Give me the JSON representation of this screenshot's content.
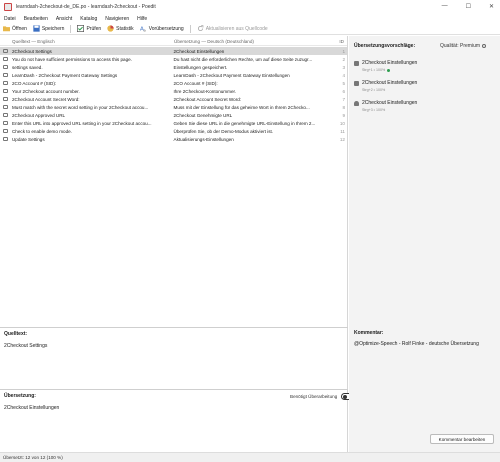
{
  "window": {
    "title": "learndash-2checkout-de_DE.po - learndash-2checkout - Poedit",
    "min": "—",
    "max": "☐",
    "close": "✕"
  },
  "menu": [
    "Datei",
    "Bearbeiten",
    "Ansicht",
    "Katalog",
    "Navigieren",
    "Hilfe"
  ],
  "toolbar": {
    "open": "Öffnen",
    "save": "Speichern",
    "validate": "Prüfen",
    "stats": "Statistik",
    "pretranslate": "Vorübersetzung",
    "update": "Aktualisieren aus Quellcode"
  },
  "list": {
    "headers": {
      "source": "Quelltext — Englisch",
      "target": "Übersetzung — Deutsch (Deutschland)",
      "id": "ID"
    },
    "rows": [
      {
        "src": "2Checkout Settings",
        "tgt": "2Checkout Einstellungen",
        "id": "1",
        "selected": true
      },
      {
        "src": "You do not have sufficient permissions to access this page.",
        "tgt": "Du hast nicht die erforderlichen Rechte, um auf diese Seite zuzugr...",
        "id": "2"
      },
      {
        "src": "settings saved.",
        "tgt": "Einstellungen gespeichert.",
        "id": "3"
      },
      {
        "src": "LearnDash - 2Checkout Payment Gateway Settings",
        "tgt": "LearnDash - 2Checkout Payment Gateway Einstellungen",
        "id": "4"
      },
      {
        "src": "2CO Account # (SID):",
        "tgt": "2CO Account # (SID):",
        "id": "5"
      },
      {
        "src": "Your 2Checkout account number.",
        "tgt": "Ihre 2Checkout-Kontonummer.",
        "id": "6"
      },
      {
        "src": "2Checkout Account Secret Word:",
        "tgt": "2Checkout Account Secret Word:",
        "id": "7"
      },
      {
        "src": "Must match with the secret word setting in your 2Checkout accou...",
        "tgt": "Muss mit der Einstellung für das geheime Wort in Ihrem 2Checko...",
        "id": "8"
      },
      {
        "src": "2Checkout Approved URL",
        "tgt": "2Checkout Genehmigte URL",
        "id": "9"
      },
      {
        "src": "Enter this URL into approved URL setting in your 2Checkout accou...",
        "tgt": "Geben Sie diese URL in die genehmigte URL-Einstellung in Ihrem 2...",
        "id": "10"
      },
      {
        "src": "Check to enable demo mode.",
        "tgt": "Überprüfen Sie, ob der Demo-Modus aktiviert ist.",
        "id": "11"
      },
      {
        "src": "Update Settings",
        "tgt": "Aktualisierungs-Einstellungen",
        "id": "12"
      }
    ]
  },
  "source_panel": {
    "label": "Quelltext:",
    "text": "2Checkout Settings"
  },
  "translation_panel": {
    "label": "Übersetzung:",
    "fuzzy_label": "Benötigt Überarbeitung",
    "fuzzy_on": false,
    "text": "2Checkout Einstellungen"
  },
  "suggestions": {
    "heading": "Übersetzungsvorschläge:",
    "quality": "Qualität: Premium",
    "items": [
      {
        "text": "2Checkout Einstellungen",
        "meta": "Strg+1 • 100%",
        "icon": "tm-icon",
        "verified": true
      },
      {
        "text": "2Checkout Einstellungen",
        "meta": "Strg+2 • 100%",
        "icon": "tm-icon",
        "verified": false
      },
      {
        "text": "2Checkout Einstellungen",
        "meta": "Strg+3 • 100%",
        "icon": "user-icon",
        "verified": false
      }
    ]
  },
  "comment": {
    "heading": "Kommentar:",
    "text": "@Optimize-Speech - Rolf Finke - deutsche Übersetzung",
    "edit_button": "Kommentar bearbeiten"
  },
  "status": {
    "text": "Übersetzt: 12 von 12 (100 %)"
  }
}
